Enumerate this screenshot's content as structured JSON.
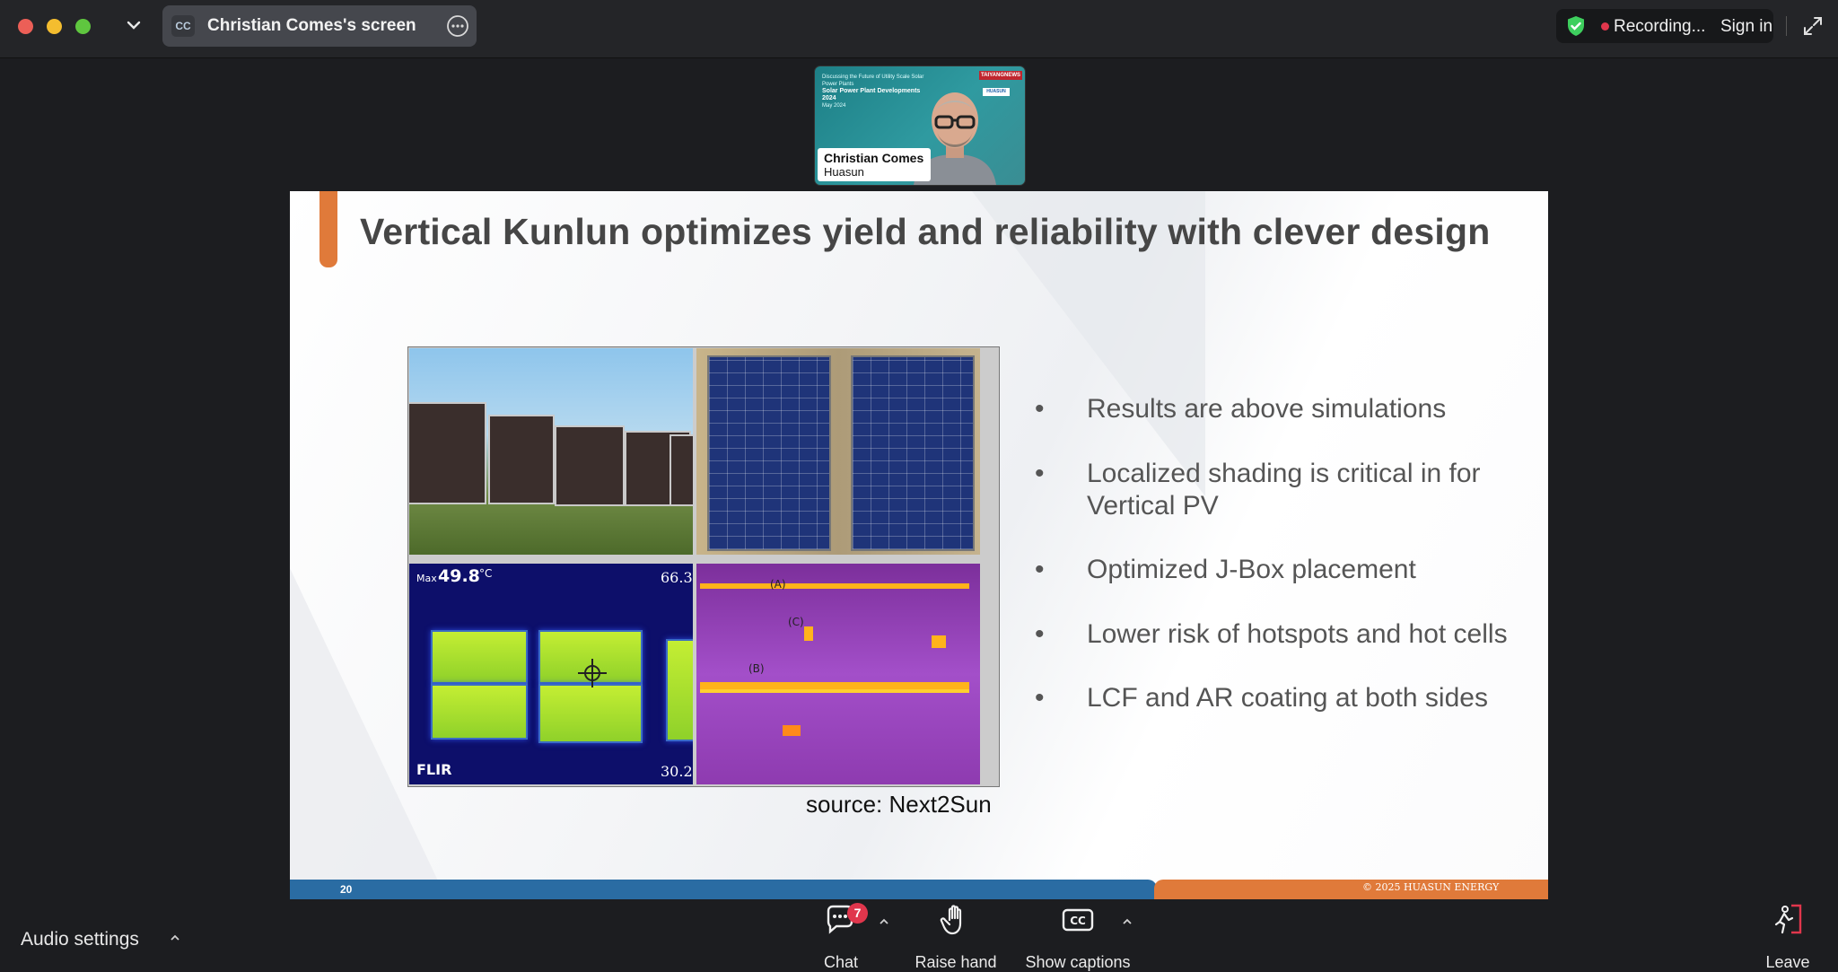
{
  "window": {
    "share_tab_initials": "CC",
    "share_tab_title": "Christian Comes's screen",
    "recording_label": "Recording...",
    "sign_in_label": "Sign in"
  },
  "speaker": {
    "name": "Christian Comes",
    "organization": "Huasun",
    "background_slide_lines": [
      "Discussing the Future of Utility Scale Solar Power Plants",
      "Solar Power Plant Developments 2024",
      "May 2024"
    ],
    "brand": "TAIYANGNEWS",
    "sponsor": "HUASUN"
  },
  "slide": {
    "title": "Vertical Kunlun optimizes yield and reliability with clever design",
    "bullets": [
      "Results are above simulations",
      "Localized shading is critical in for Vertical PV",
      "Optimized J-Box placement",
      "Lower risk of hotspots and hot cells",
      "LCF and AR coating at both sides"
    ],
    "source": "source: Next2Sun",
    "page_number": "20",
    "copyright": "© 2025 HUASUN ENERGY",
    "ir_image": {
      "max_prefix": "Max",
      "max_value": "49.8",
      "unit": "°C",
      "scale_high": "66.3",
      "scale_low": "30.2",
      "camera_brand": "FLIR"
    },
    "ir_labels": [
      "(A)",
      "(C)",
      "(B)"
    ]
  },
  "bottom_bar": {
    "audio_settings": "Audio settings",
    "chat": "Chat",
    "chat_badge": "7",
    "raise_hand": "Raise hand",
    "show_captions": "Show captions",
    "leave": "Leave"
  },
  "colors": {
    "accent_orange": "#e07a3a",
    "footer_blue": "#2a6ca3",
    "recording_red": "#e0364c",
    "shield_green": "#3ecf5e"
  },
  "icons": [
    "chevron-down-icon",
    "more-options-icon",
    "shield-check-icon",
    "fullscreen-icon",
    "chat-icon",
    "raise-hand-icon",
    "captions-icon",
    "leave-icon"
  ]
}
